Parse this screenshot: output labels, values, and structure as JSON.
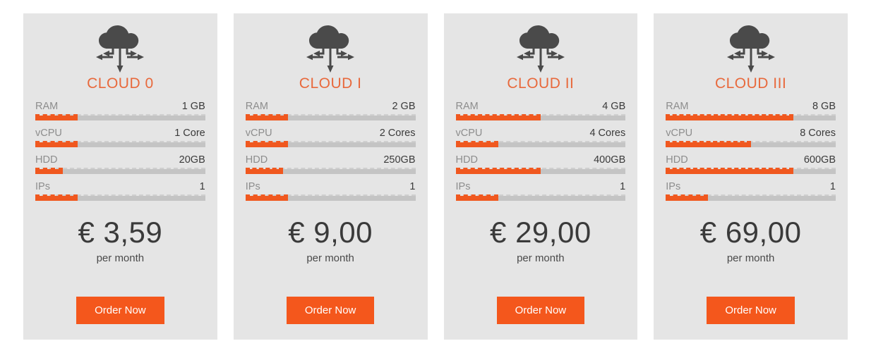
{
  "theme": {
    "page_background": "#ffffff",
    "card_background": "#e5e5e5",
    "title_color": "#e8693c",
    "bar_fill_color": "#f0581f",
    "bar_track_color": "#c4c4c4",
    "button_color": "#f4571c",
    "icon_color": "#4a4a4a"
  },
  "spec_labels": {
    "ram": "RAM",
    "vcpu": "vCPU",
    "hdd": "HDD",
    "ips": "IPs"
  },
  "plans": [
    {
      "id": "cloud-0",
      "title": "CLOUD 0",
      "icon": "cloud-network-icon",
      "specs": [
        {
          "label": "RAM",
          "value": "1 GB",
          "fill_percent": 25
        },
        {
          "label": "vCPU",
          "value": "1 Core",
          "fill_percent": 25
        },
        {
          "label": "HDD",
          "value": "20GB",
          "fill_percent": 16
        },
        {
          "label": "IPs",
          "value": "1",
          "fill_percent": 25
        }
      ],
      "price": "€ 3,59",
      "period": "per month",
      "cta_label": "Order Now"
    },
    {
      "id": "cloud-1",
      "title": "CLOUD I",
      "icon": "cloud-network-icon",
      "specs": [
        {
          "label": "RAM",
          "value": "2 GB",
          "fill_percent": 25
        },
        {
          "label": "vCPU",
          "value": "2 Cores",
          "fill_percent": 25
        },
        {
          "label": "HDD",
          "value": "250GB",
          "fill_percent": 22
        },
        {
          "label": "IPs",
          "value": "1",
          "fill_percent": 25
        }
      ],
      "price": "€ 9,00",
      "period": "per month",
      "cta_label": "Order Now"
    },
    {
      "id": "cloud-2",
      "title": "CLOUD II",
      "icon": "cloud-network-icon",
      "specs": [
        {
          "label": "RAM",
          "value": "4 GB",
          "fill_percent": 50
        },
        {
          "label": "vCPU",
          "value": "4 Cores",
          "fill_percent": 25
        },
        {
          "label": "HDD",
          "value": "400GB",
          "fill_percent": 50
        },
        {
          "label": "IPs",
          "value": "1",
          "fill_percent": 25
        }
      ],
      "price": "€ 29,00",
      "period": "per month",
      "cta_label": "Order Now"
    },
    {
      "id": "cloud-3",
      "title": "CLOUD III",
      "icon": "cloud-network-icon",
      "specs": [
        {
          "label": "RAM",
          "value": "8 GB",
          "fill_percent": 75
        },
        {
          "label": "vCPU",
          "value": "8 Cores",
          "fill_percent": 50
        },
        {
          "label": "HDD",
          "value": "600GB",
          "fill_percent": 75
        },
        {
          "label": "IPs",
          "value": "1",
          "fill_percent": 25
        }
      ],
      "price": "€ 69,00",
      "period": "per month",
      "cta_label": "Order Now"
    }
  ]
}
